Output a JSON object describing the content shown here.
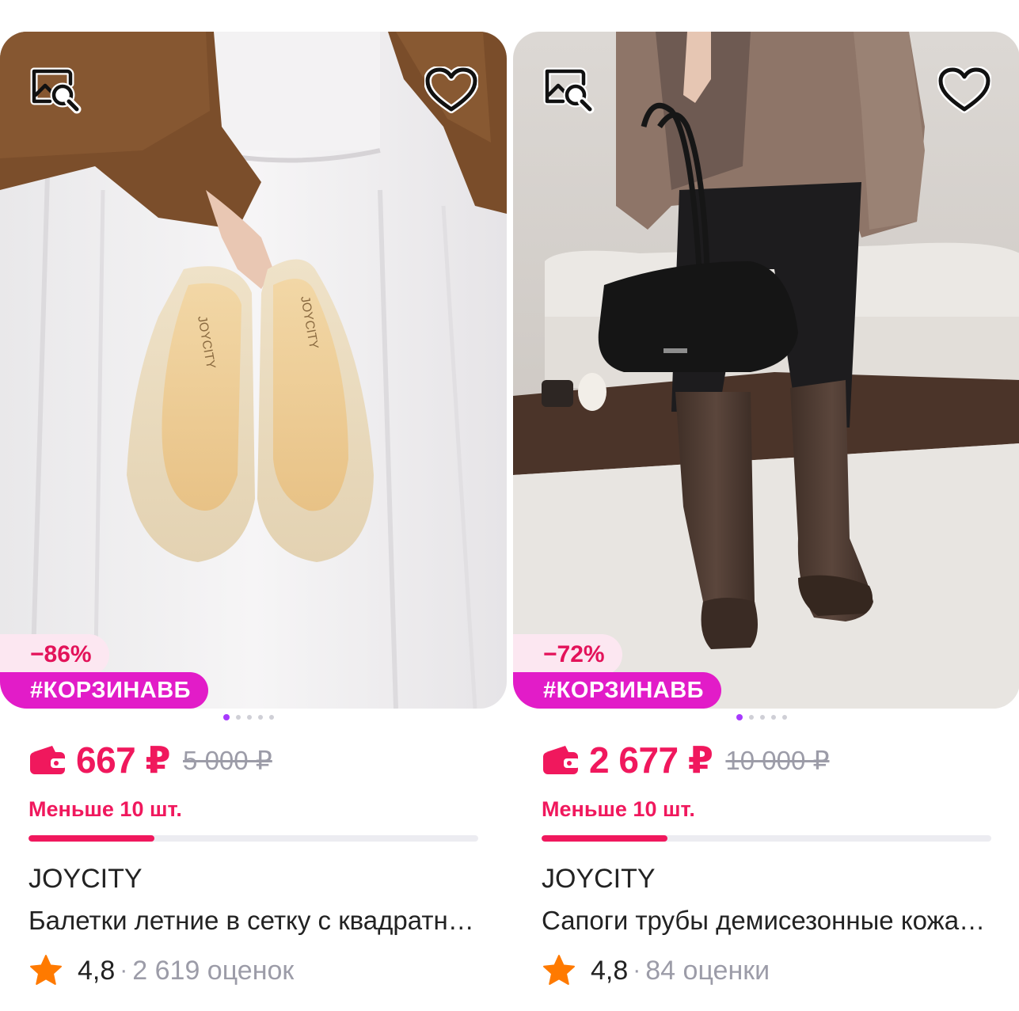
{
  "products": [
    {
      "image_alt": "Балетки",
      "discount": "−86%",
      "promo_tag": "#КОРЗИНАВБ",
      "price": "667 ₽",
      "old_price": "5 000 ₽",
      "stock_text": "Меньше 10 шт.",
      "stock_level": 0.28,
      "brand": "JOYCITY",
      "title": "Балетки летние в сетку с квадратным носом",
      "rating": "4,8",
      "separator": "·",
      "reviews": "2 619 оценок",
      "slide_count": 5,
      "active_slide": 0
    },
    {
      "image_alt": "Сапоги",
      "discount": "−72%",
      "promo_tag": "#КОРЗИНАВБ",
      "price": "2 677 ₽",
      "old_price": "10 000 ₽",
      "stock_text": "Меньше 10 шт.",
      "stock_level": 0.28,
      "brand": "JOYCITY",
      "title": "Сапоги трубы демисезонные кожаные",
      "rating": "4,8",
      "separator": "·",
      "reviews": "84 оценки",
      "slide_count": 5,
      "active_slide": 0
    }
  ],
  "icons": {
    "find_similar": "find-similar-icon",
    "favorite": "heart-icon",
    "wallet": "wallet-icon",
    "star": "star-icon"
  },
  "colors": {
    "accent": "#f0185d",
    "promo": "#e21cc8",
    "discount_bg": "#fce7f1",
    "star": "#ff7a00",
    "dot_active": "#a73afd"
  }
}
